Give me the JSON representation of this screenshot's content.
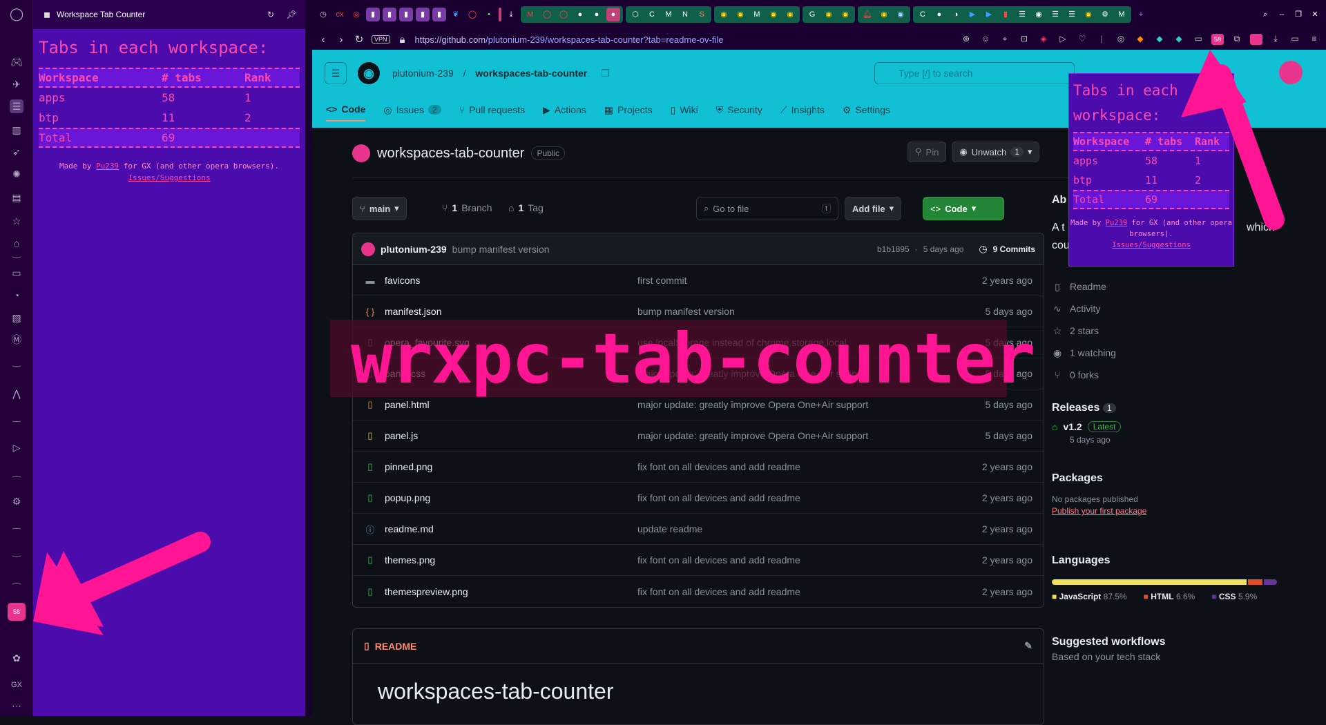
{
  "gx_sidebar": {
    "icons": [
      "opera-logo-icon",
      "controller-icon",
      "twitch-icon",
      "sidebar-list-icon",
      "panel-icon",
      "rocket-icon",
      "gear-badge-icon",
      "doc-icon",
      "star-icon",
      "bag-icon",
      "controller2-icon",
      "gauge-icon",
      "striped-icon",
      "m-square-icon",
      "ai-icon",
      "send-icon",
      "settings-icon",
      "workspace-tab-counter-icon",
      "cherry-icon",
      "gx-icon",
      "more-icon"
    ],
    "ext_badge": "58",
    "gx_label": "GX"
  },
  "panel": {
    "title_bar": "Workspace Tab Counter",
    "heading": "Tabs in each workspace:",
    "table": {
      "headers": [
        "Workspace",
        "# tabs",
        "Rank"
      ],
      "rows": [
        {
          "workspace": "apps",
          "tabs": "58",
          "rank": "1"
        },
        {
          "workspace": "btp",
          "tabs": "11",
          "rank": "2"
        }
      ],
      "total": {
        "label": "Total",
        "tabs": "69"
      }
    },
    "credit_prefix": "Made by ",
    "credit_author": "Pu239",
    "credit_suffix": " for GX (and other opera browsers).",
    "credit_link": "Issues/Suggestions"
  },
  "browser": {
    "vpn_label": "VPN",
    "url_host": "https://github.com",
    "url_path": "/plutonium-239/workspaces-tab-counter?tab=readme-ov-file",
    "toolbar_badge": "58"
  },
  "github": {
    "owner": "plutonium-239",
    "repo": "workspaces-tab-counter",
    "search_placeholder": "Type [/] to search",
    "tabs": [
      {
        "label": "Code",
        "icon": "code-icon"
      },
      {
        "label": "Issues",
        "icon": "issue-icon",
        "badge": "2"
      },
      {
        "label": "Pull requests",
        "icon": "pr-icon"
      },
      {
        "label": "Actions",
        "icon": "play-icon"
      },
      {
        "label": "Projects",
        "icon": "table-icon"
      },
      {
        "label": "Wiki",
        "icon": "book-icon"
      },
      {
        "label": "Security",
        "icon": "shield-icon"
      },
      {
        "label": "Insights",
        "icon": "graph-icon"
      },
      {
        "label": "Settings",
        "icon": "gear-icon"
      }
    ],
    "visibility": "Public",
    "pin_label": "Pin",
    "unwatch_label": "Unwatch",
    "watch_count": "1",
    "branch": "main",
    "branch_count": "1",
    "branch_label": "Branch",
    "tag_count": "1",
    "tag_label": "Tag",
    "goto_placeholder": "Go to file",
    "goto_key": "t",
    "add_file": "Add file",
    "code_btn": "Code",
    "last_commit": {
      "author": "plutonium-239",
      "message": "bump manifest version",
      "hash": "b1b1895",
      "when": "5 days ago",
      "commits": "9 Commits"
    },
    "files": [
      {
        "name": "favicons",
        "icon": "folder-icon",
        "msg": "first commit",
        "date": "2 years ago"
      },
      {
        "name": "manifest.json",
        "icon": "json-icon",
        "msg": "bump manifest version",
        "date": "5 days ago"
      },
      {
        "name": "opera_favourite.svg",
        "icon": "file-icon",
        "msg": "use localStorage instead of chrome.storage.local",
        "date": "5 days ago"
      },
      {
        "name": "panel.css",
        "icon": "css-icon",
        "msg": "major update: greatly improve Opera One+Air support",
        "date": "5 days ago"
      },
      {
        "name": "panel.html",
        "icon": "html-icon",
        "msg": "major update: greatly improve Opera One+Air support",
        "date": "5 days ago"
      },
      {
        "name": "panel.js",
        "icon": "js-icon",
        "msg": "major update: greatly improve Opera One+Air support",
        "date": "5 days ago"
      },
      {
        "name": "pinned.png",
        "icon": "image-icon",
        "msg": "fix font on all devices and add readme",
        "date": "2 years ago"
      },
      {
        "name": "popup.png",
        "icon": "image-icon",
        "msg": "fix font on all devices and add readme",
        "date": "2 years ago"
      },
      {
        "name": "readme.md",
        "icon": "info-icon",
        "msg": "update readme",
        "date": "2 years ago"
      },
      {
        "name": "themes.png",
        "icon": "image-icon",
        "msg": "fix font on all devices and add readme",
        "date": "2 years ago"
      },
      {
        "name": "themespreview.png",
        "icon": "image-icon",
        "msg": "fix font on all devices and add readme",
        "date": "2 years ago"
      }
    ],
    "readme_tab": "README",
    "readme_h1": "workspaces-tab-counter",
    "about": {
      "heading": "Ab",
      "desc_a": "A t",
      "desc_b": "which",
      "desc_c": "cou"
    },
    "side_links": [
      {
        "icon": "book-icon",
        "label": "Readme"
      },
      {
        "icon": "pulse-icon",
        "label": "Activity"
      },
      {
        "icon": "star-icon",
        "label": "2 stars"
      },
      {
        "icon": "eye-icon",
        "label": "1 watching"
      },
      {
        "icon": "fork-icon",
        "label": "0 forks"
      }
    ],
    "releases": {
      "heading": "Releases",
      "count": "1",
      "version": "v1.2",
      "latest": "Latest",
      "when": "5 days ago"
    },
    "packages": {
      "heading": "Packages",
      "none": "No packages published",
      "link": "Publish your first package"
    },
    "languages": {
      "heading": "Languages",
      "items": [
        {
          "name": "JavaScript",
          "pct": "87.5%",
          "value": 87.5,
          "color": "#f1e05a"
        },
        {
          "name": "HTML",
          "pct": "6.6%",
          "value": 6.6,
          "color": "#e34c26"
        },
        {
          "name": "CSS",
          "pct": "5.9%",
          "value": 5.9,
          "color": "#663399"
        }
      ]
    },
    "suggested": {
      "heading": "Suggested workflows",
      "sub": "Based on your tech stack"
    }
  },
  "overlay": {
    "banner": "wrxpc-tab-counter"
  },
  "colors": {
    "accent": "#ff4aa8",
    "panel_bg": "#4c0cad",
    "gh_header": "#12c0d6",
    "arrow": "#ff1493"
  }
}
